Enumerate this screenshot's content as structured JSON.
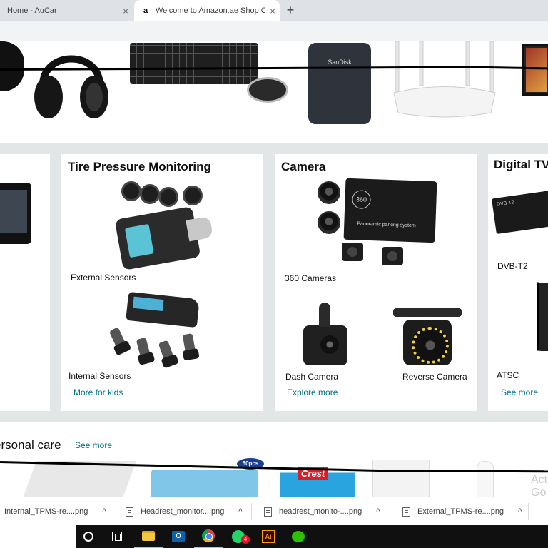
{
  "browser": {
    "tabs": [
      {
        "title": "Home - AuCar",
        "favicon": "page-icon"
      },
      {
        "title": "Welcome to Amazon.ae Shop Onli",
        "favicon": "amazon-a-icon",
        "active": true
      }
    ],
    "favicon_letter": "a",
    "close_glyph": "×",
    "new_tab_glyph": "+"
  },
  "banner": {
    "ssd_brand": "SanDisk",
    "products": [
      "headphones",
      "keyboard",
      "mouse",
      "portable-ssd",
      "wifi-router",
      "monitor"
    ]
  },
  "cards": {
    "tpms": {
      "title": "Tire Pressure Monitoring",
      "items": [
        {
          "label": "External Sensors"
        },
        {
          "label": "Internal Sensors"
        }
      ],
      "link": "More for kids"
    },
    "camera": {
      "title": "Camera",
      "box_logo": "360",
      "box_text": "Panoramic parking system",
      "items": [
        {
          "label": "360 Cameras"
        },
        {
          "label": "Dash Camera"
        },
        {
          "label": "Reverse Camera"
        }
      ],
      "link": "Explore more"
    },
    "tv": {
      "title": "Digital TV",
      "box_text": "DVB-T2",
      "items": [
        {
          "label": "DVB-T2"
        },
        {
          "label": "ATSC"
        }
      ],
      "link": "See more"
    }
  },
  "personal_care": {
    "title": "Personal care",
    "title_visible": "ersonal care",
    "link": "See more",
    "mask_tag": "50pcs",
    "crest_brand": "Crest",
    "watermark": [
      "Act",
      "Go t"
    ]
  },
  "downloads": [
    {
      "name": "Internal_TPMS-re....png"
    },
    {
      "name": "Headrest_monitor....png"
    },
    {
      "name": "headrest_monito-....png"
    },
    {
      "name": "External_TPMS-re....png"
    }
  ],
  "download_chevron": "^",
  "taskbar": {
    "apps": [
      "start-button",
      "task-view",
      "file-explorer",
      "outlook",
      "chrome",
      "whatsapp",
      "illustrator",
      "wechat"
    ],
    "outlook_letter": "O",
    "illustrator_letters": "Ai",
    "whatsapp_badge": "4"
  },
  "colors": {
    "link": "#007185",
    "page_bg": "#e3e6e6",
    "tab_strip": "#dee1e6"
  }
}
